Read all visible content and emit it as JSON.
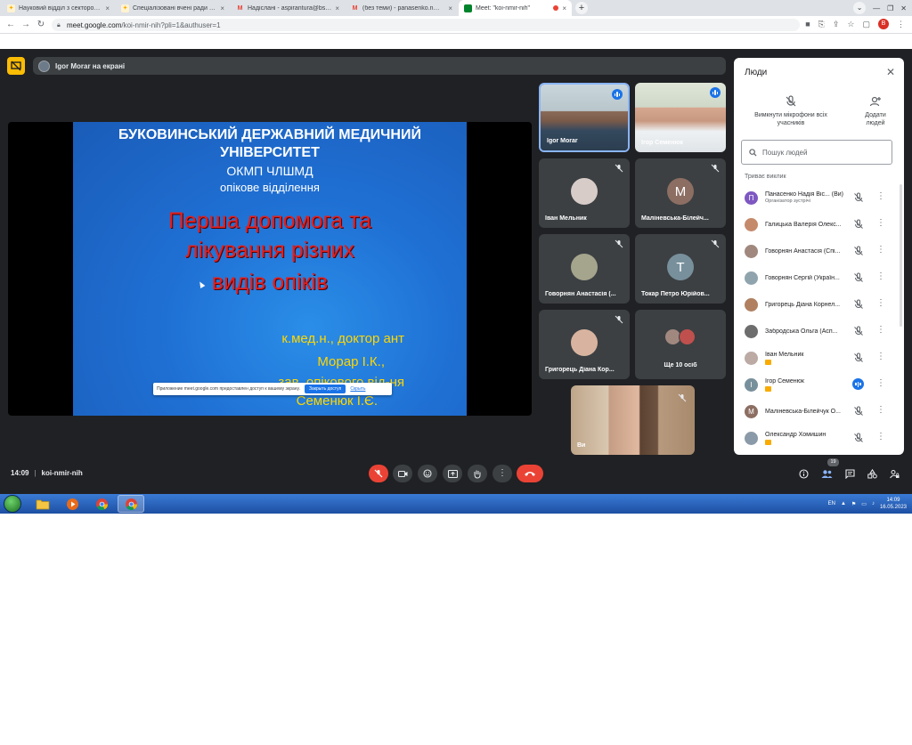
{
  "browser": {
    "tabs": [
      {
        "title": "Науковий відділ з сектором ін...",
        "favicon_color": "#f9ab00",
        "close": "×"
      },
      {
        "title": "Спеціалізовані вчені ради із за...",
        "favicon_color": "#f9ab00",
        "close": "×"
      },
      {
        "title": "Надіслані - aspirantura@bsmu.e...",
        "favicon_color": "#ea4335",
        "close": "×"
      },
      {
        "title": "(без теми) - panasenko.n@bsmu...",
        "favicon_color": "#ea4335",
        "close": "×"
      },
      {
        "title": "Meet: \"koi-nmir-nih\"",
        "favicon_color": "#00832d",
        "close": "×"
      }
    ],
    "new_tab": "+",
    "url_host": "meet.google.com",
    "url_path": "/koi-nmir-nih?pli=1&authuser=1",
    "profile_initial": "B"
  },
  "meet": {
    "presenting_banner": "Igor Morar на екрані",
    "slide": {
      "line1": "БУКОВИНСЬКИЙ ДЕРЖАВНИЙ МЕДИЧНИЙ",
      "line2": "УНІВЕРСИТЕТ",
      "line3": "ОКМП ЧЛШМД",
      "line4": "опікове відділення",
      "title1": "Перша допомога та",
      "title2": "лікування різних",
      "title3": "видів опіків",
      "author1": "к.мед.н., доктор ант",
      "author2": "Морар І.К.,",
      "author3": "зав. опікового від-ня",
      "author4": "Семенюк І.Є."
    },
    "share_notice": {
      "text": "Приложение meet.google.com предоставлен доступ к вашему экрану.",
      "button": "Закрыть доступ",
      "link": "Скрыть"
    },
    "tiles": [
      {
        "name": "Igor Morar"
      },
      {
        "name": "Ігор Семенюк"
      },
      {
        "name": "Іван Мельник"
      },
      {
        "name": "Маліневська-Білейч...",
        "initial": "М",
        "color": "#8d6e63"
      },
      {
        "name": "Говорнян Анастасія (..."
      },
      {
        "name": "Токар Петро Юрійов...",
        "initial": "Т",
        "color": "#78909c"
      },
      {
        "name": "Григорець Діана Кор..."
      },
      {
        "name": "Ще 10 осіб"
      },
      {
        "name": "Ви"
      }
    ],
    "time": "14:09",
    "meeting_code": "koi-nmir-nih",
    "participant_count": "19"
  },
  "people_panel": {
    "title": "Люди",
    "mute_all": "Вимкнути мікрофони всіх учасників",
    "add_people": "Додати людей",
    "search_placeholder": "Пошук людей",
    "section": "Триває виклик",
    "participants": [
      {
        "name": "Панасенко Надія Віс... (Ви)",
        "sub": "Організатор зустрічі",
        "initial": "П",
        "color": "#7e57c2"
      },
      {
        "name": "Галицька Валерія Олекс...",
        "color": "#c58a6b"
      },
      {
        "name": "Говорнян Анастасія (Спі...",
        "color": "#a1887f"
      },
      {
        "name": "Говорнян Сергій (Україн...",
        "color": "#90a4ae"
      },
      {
        "name": "Григорець Діана Корнел...",
        "color": "#b08060"
      },
      {
        "name": "Забродська Ольга (Асп...",
        "color": "#6d6d6d"
      },
      {
        "name": "Іван Мельник",
        "color": "#bcaaa4"
      },
      {
        "name": "Ігор Семенюк",
        "initial": "І",
        "color": "#78909c"
      },
      {
        "name": "Маліневська-Білейчук О...",
        "initial": "М",
        "color": "#8d6e63"
      },
      {
        "name": "Олександр Хомишин",
        "color": "#8a9aa8"
      }
    ]
  },
  "taskbar": {
    "lang": "EN",
    "time": "14:09",
    "date": "16.05.2023"
  }
}
